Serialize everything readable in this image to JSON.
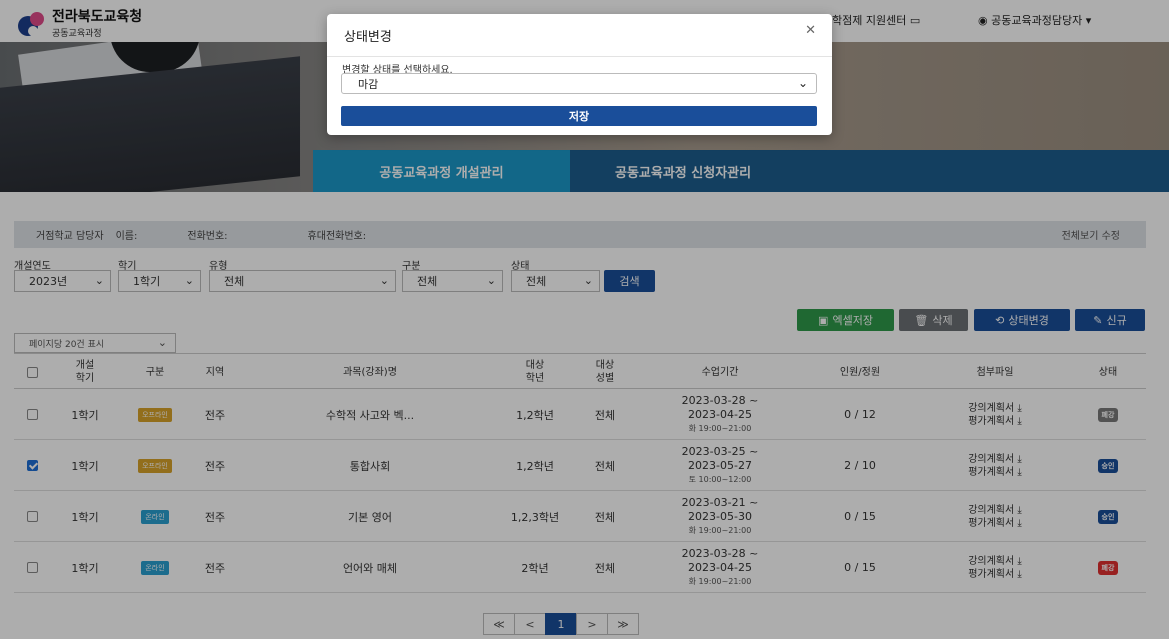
{
  "header": {
    "org_name": "전라북도교육청",
    "org_sub": "공동교육과정",
    "support_center": "학점제 지원센터",
    "user_menu": "공동교육과정담당자"
  },
  "tabs": [
    "공동교육과정 개설관리",
    "공동교육과정 신청자관리"
  ],
  "info_bar": {
    "role": "거점학교 담당자",
    "name_label": "이름:",
    "phone_label": "전화번호:",
    "mobile_label": "휴대전화번호:",
    "edit_link": "전체보기 수정"
  },
  "filters": {
    "year": {
      "label": "개설연도",
      "value": "2023년"
    },
    "semester": {
      "label": "학기",
      "value": "1학기"
    },
    "type": {
      "label": "유형",
      "value": "전체"
    },
    "category": {
      "label": "구분",
      "value": "전체"
    },
    "status": {
      "label": "상태",
      "value": "전체"
    },
    "search_button": "검색"
  },
  "actions": {
    "excel": "엑셀저장",
    "delete": "삭제",
    "change_status": "상태변경",
    "new": "신규"
  },
  "per_page": "페이지당 20건 표시",
  "table": {
    "headers": {
      "semester": "개설\n학기",
      "category": "구분",
      "region": "지역",
      "course": "과목(강좌)명",
      "grade": "대상\n학년",
      "gender": "대상\n성별",
      "period": "수업기간",
      "people": "인원/정원",
      "files": "첨부파일",
      "status": "상태"
    },
    "rows": [
      {
        "checked": false,
        "semester": "1학기",
        "category": "오프라인",
        "category_color": "#d8a32a",
        "region": "전주",
        "course": "수학적 사고와 벡...",
        "grade": "1,2학년",
        "gender": "전체",
        "start": "2023-03-28 ~",
        "end": "2023-04-25",
        "time": "화 19:00~21:00",
        "people": "0 / 12",
        "file1": "강의계획서",
        "file2": "평가계획서",
        "status": "폐강",
        "status_color": "#7a7a7a"
      },
      {
        "checked": true,
        "semester": "1학기",
        "category": "오프라인",
        "category_color": "#d8a32a",
        "region": "전주",
        "course": "통합사회",
        "grade": "1,2학년",
        "gender": "전체",
        "start": "2023-03-25 ~",
        "end": "2023-05-27",
        "time": "토 10:00~12:00",
        "people": "2 / 10",
        "file1": "강의계획서",
        "file2": "평가계획서",
        "status": "승인",
        "status_color": "#1a4e9a"
      },
      {
        "checked": false,
        "semester": "1학기",
        "category": "온라인",
        "category_color": "#2a9fd0",
        "region": "전주",
        "course": "기본 영어",
        "grade": "1,2,3학년",
        "gender": "전체",
        "start": "2023-03-21 ~",
        "end": "2023-05-30",
        "time": "화 19:00~21:00",
        "people": "0 / 15",
        "file1": "강의계획서",
        "file2": "평가계획서",
        "status": "승인",
        "status_color": "#1a4e9a"
      },
      {
        "checked": false,
        "semester": "1학기",
        "category": "온라인",
        "category_color": "#2a9fd0",
        "region": "전주",
        "course": "언어와 매체",
        "grade": "2학년",
        "gender": "전체",
        "start": "2023-03-28 ~",
        "end": "2023-04-25",
        "time": "화 19:00~21:00",
        "people": "0 / 15",
        "file1": "강의계획서",
        "file2": "평가계획서",
        "status": "폐강",
        "status_color": "#e03030"
      }
    ]
  },
  "pagination": {
    "first": "≪",
    "prev": "<",
    "current": "1",
    "next": ">",
    "last": "≫"
  },
  "modal": {
    "title": "상태변경",
    "label": "변경할 상태를 선택하세요.",
    "selected": "마감",
    "save": "저장"
  }
}
